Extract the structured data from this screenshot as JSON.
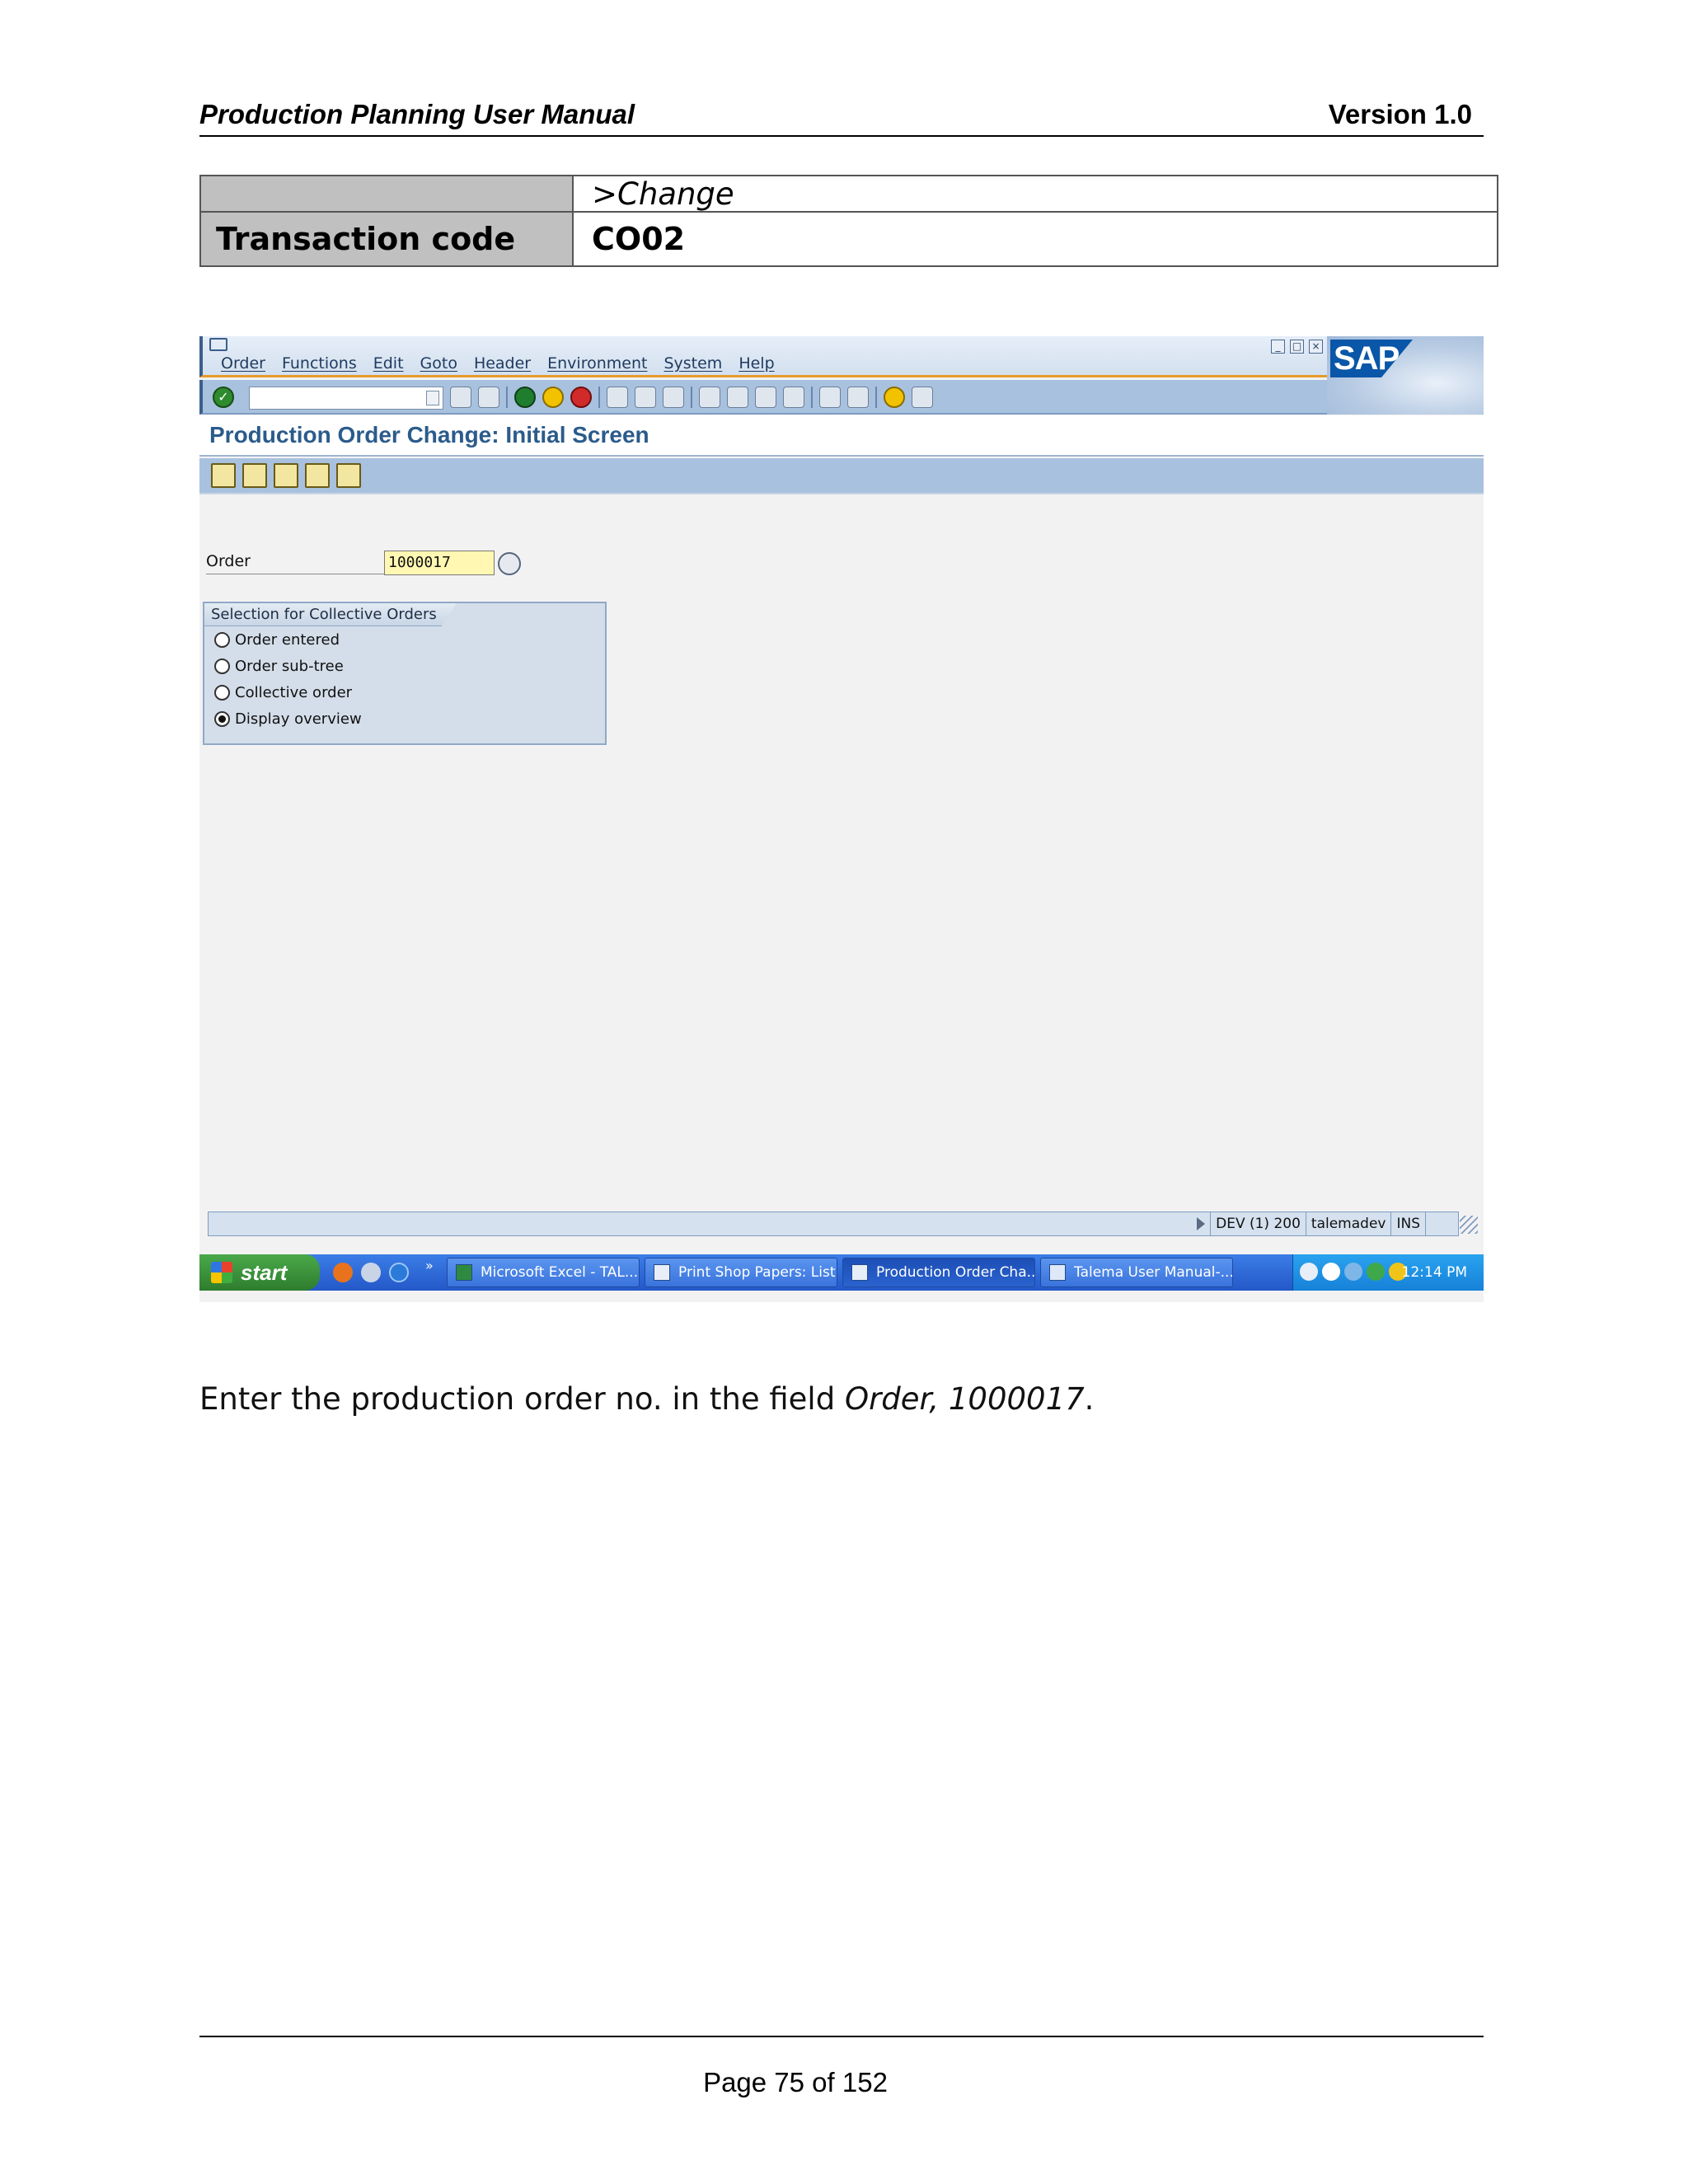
{
  "document": {
    "title": "Production Planning User Manual",
    "version": "Version 1.0",
    "footer_page": "Page 75 of 152"
  },
  "transaction": {
    "menu_path": ">Change",
    "label": "Transaction code",
    "code": "CO02"
  },
  "sap": {
    "menu": [
      "Order",
      "Functions",
      "Edit",
      "Goto",
      "Header",
      "Environment",
      "System",
      "Help"
    ],
    "logo_text": "SAP",
    "screen_title": "Production Order Change: Initial Screen",
    "order_field": {
      "label": "Order",
      "value": "1000017"
    },
    "collective": {
      "title": "Selection for Collective Orders",
      "options": [
        {
          "label": "Order entered",
          "selected": false
        },
        {
          "label": "Order sub-tree",
          "selected": false
        },
        {
          "label": "Collective order",
          "selected": false
        },
        {
          "label": "Display overview",
          "selected": true
        }
      ]
    },
    "status_bar": {
      "system": "DEV (1) 200",
      "user": "talemadev",
      "mode": "INS"
    }
  },
  "taskbar": {
    "start_label": "start",
    "items": [
      {
        "label": "Microsoft Excel - TAL...",
        "active": false
      },
      {
        "label": "Print Shop Papers: List",
        "active": false
      },
      {
        "label": "Production Order Cha...",
        "active": true
      },
      {
        "label": "Talema User Manual-...",
        "active": false
      }
    ],
    "clock": "12:14 PM"
  },
  "instruction": {
    "prefix": "Enter the production order no. in the field ",
    "emphasis": "Order, 1000017",
    "suffix": "."
  }
}
